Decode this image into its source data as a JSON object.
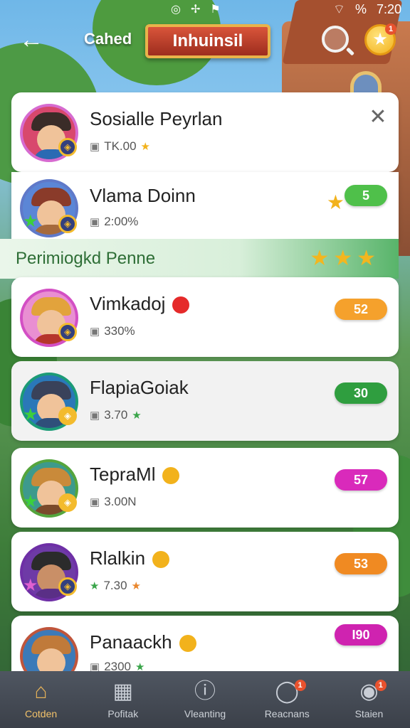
{
  "status": {
    "time": "7:20",
    "battery": "%"
  },
  "header": {
    "back_icon": "arrow-left-icon",
    "label": "Cahed",
    "title": "Inhuinsil",
    "search_icon": "search-icon",
    "star_icon": "star-coin-icon",
    "star_badge": "1"
  },
  "cards": [
    {
      "name": "Sosialle Peyrlan",
      "stat": "TK.00",
      "stat_icon": "star",
      "action": "close"
    },
    {
      "name": "Vlama Doinn",
      "stat": "2:00%",
      "pill": "5",
      "pill_color": "#4fc04a"
    }
  ],
  "section": {
    "title": "Perimiogkd Penne",
    "stars": "★★★"
  },
  "players": [
    {
      "name": "Vimkadoj",
      "stat": "330%",
      "pill": "52",
      "pill_color": "#f5a12c",
      "accent": "#e52a2a",
      "ring": "#d34fc4"
    },
    {
      "name": "FlapiaGoiak",
      "stat": "3.70",
      "stat_star": "green",
      "pill": "30",
      "pill_color": "#2f9e3f",
      "ring": "#1c9b77"
    },
    {
      "name": "TepraMl",
      "stat": "3.00N",
      "pill": "57",
      "pill_color": "#d92abb",
      "accent": "#f2b21c",
      "ring": "#55a53c"
    },
    {
      "name": "Rlalkin",
      "stat": "7.30",
      "stat_star": "orange",
      "pill": "53",
      "pill_color": "#f08a22",
      "accent": "#f2b21c",
      "ring": "#6e2fa6"
    },
    {
      "name": "Panaackh",
      "stat": "2300",
      "stat_star": "green",
      "pill": "I90",
      "pill_color": "#cf23b0",
      "accent": "#f2b21c",
      "ring": "#c0553b"
    }
  ],
  "nav": [
    {
      "label": "Cotden",
      "icon": "home-icon",
      "active": true
    },
    {
      "label": "Pofitak",
      "icon": "cards-icon"
    },
    {
      "label": "Vleanting",
      "icon": "info-icon"
    },
    {
      "label": "Reacnans",
      "icon": "circle-icon",
      "badge": "1"
    },
    {
      "label": "Staien",
      "icon": "profile-icon",
      "badge": "1"
    }
  ],
  "colors": {
    "accent": "#f2c26a",
    "green": "#4fc04a",
    "section_text": "#2e6e36"
  }
}
